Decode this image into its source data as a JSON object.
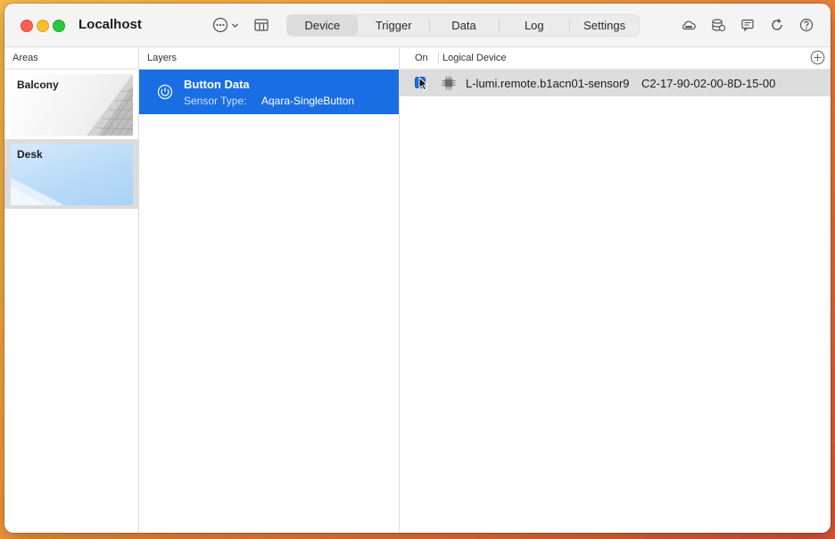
{
  "window": {
    "title": "Localhost"
  },
  "toolbar": {
    "tabs": [
      {
        "label": "Device",
        "active": true
      },
      {
        "label": "Trigger",
        "active": false
      },
      {
        "label": "Data",
        "active": false
      },
      {
        "label": "Log",
        "active": false
      },
      {
        "label": "Settings",
        "active": false
      }
    ],
    "right_icons": [
      "mqtt-cloud-icon",
      "database-icon",
      "message-icon",
      "refresh-icon",
      "help-icon"
    ],
    "left_icons": [
      "more-icon",
      "chevron-down-icon",
      "layout-icon"
    ]
  },
  "areas": {
    "header": "Areas",
    "items": [
      {
        "label": "Balcony",
        "selected": false
      },
      {
        "label": "Desk",
        "selected": true
      }
    ]
  },
  "layers": {
    "header": "Layers",
    "items": [
      {
        "title": "Button Data",
        "sensor_label": "Sensor Type:",
        "sensor_value": "Aqara-SingleButton",
        "selected": true,
        "icon": "power-icon"
      }
    ]
  },
  "devices": {
    "header_on": "On",
    "header_device": "Logical Device",
    "rows": [
      {
        "name": "L-lumi.remote.b1acn01-sensor9",
        "mac": "C2-17-90-02-00-8D-15-00",
        "on": true,
        "icon": "chip-icon"
      }
    ]
  },
  "colors": {
    "accent": "#1a6ee3",
    "selection_gray": "#dcdcdc",
    "close": "#fe5f57",
    "minimize": "#febc2e",
    "zoom": "#28c840"
  }
}
